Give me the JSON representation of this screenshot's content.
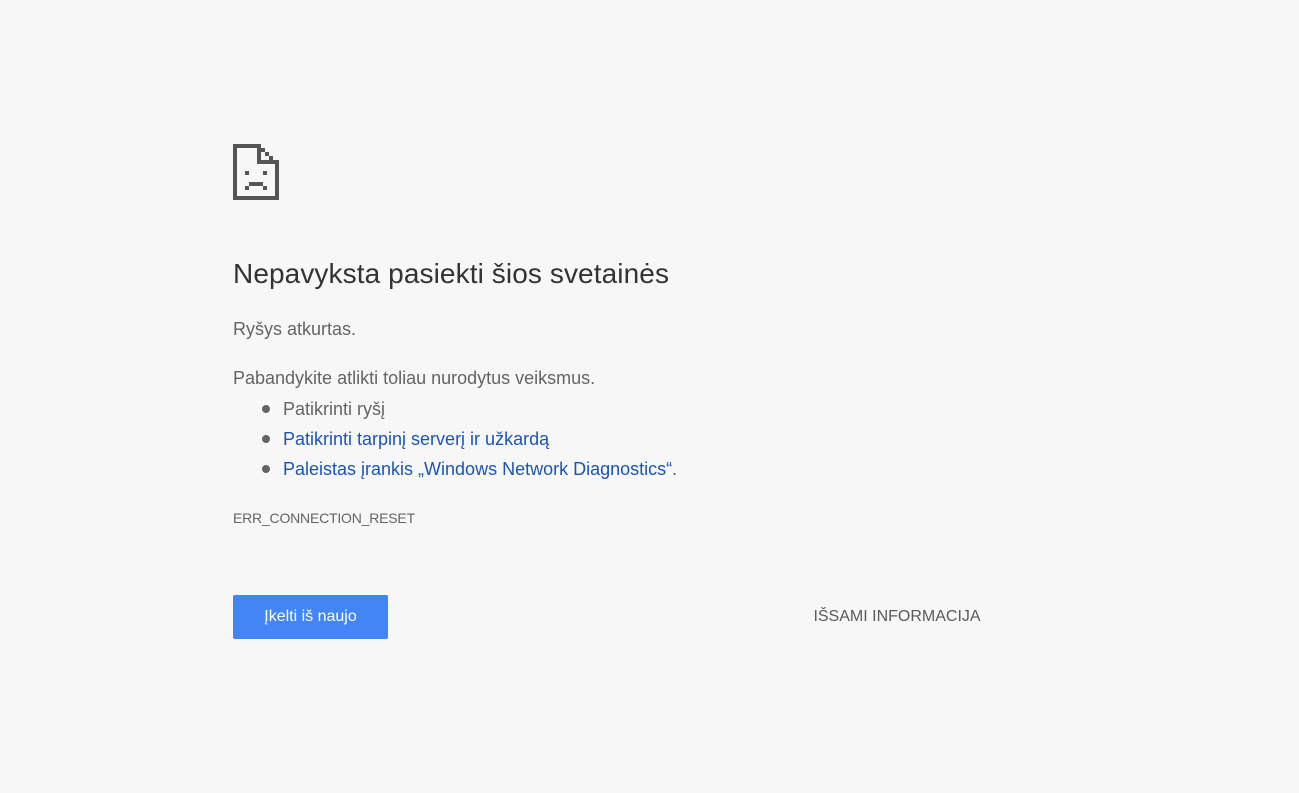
{
  "error_page": {
    "icon": "sad-page-icon",
    "title": "Nepavyksta pasiekti šios svetainės",
    "subtitle": "Ryšys atkurtas.",
    "suggestions_intro": "Pabandykite atlikti toliau nurodytus veiksmus.",
    "suggestions": [
      {
        "text": "Patikrinti ryšį",
        "is_link": false
      },
      {
        "text": "Patikrinti tarpinį serverį ir užkardą",
        "is_link": true
      },
      {
        "text": "Paleistas įrankis „Windows Network Diagnostics“",
        "is_link": true,
        "suffix": "."
      }
    ],
    "error_code": "ERR_CONNECTION_RESET",
    "reload_label": "Įkelti iš naujo",
    "details_label": "IŠSAMI INFORMACIJA"
  },
  "colors": {
    "background": "#f7f7f7",
    "button_blue": "#4285f4",
    "link": "#1a55b5",
    "text": "#646464",
    "title": "#333333"
  }
}
